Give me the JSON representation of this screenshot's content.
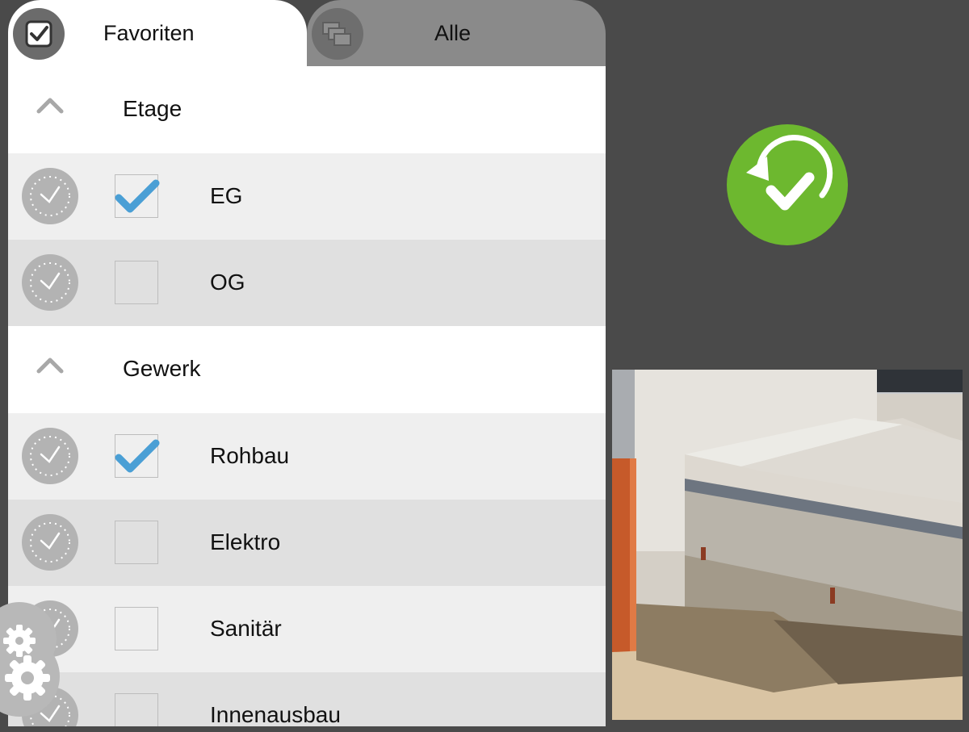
{
  "tabs": {
    "favorites": {
      "label": "Favoriten",
      "icon": "checkbox-icon",
      "active": true
    },
    "all": {
      "label": "Alle",
      "icon": "layers-icon",
      "active": false
    }
  },
  "sections": [
    {
      "title": "Etage",
      "items": [
        {
          "label": "EG",
          "checked": true
        },
        {
          "label": "OG",
          "checked": false
        }
      ]
    },
    {
      "title": "Gewerk",
      "items": [
        {
          "label": "Rohbau",
          "checked": true
        },
        {
          "label": "Elektro",
          "checked": false
        },
        {
          "label": "Sanitär",
          "checked": false
        },
        {
          "label": "Innenausbau",
          "checked": false
        }
      ]
    }
  ],
  "sync_button": {
    "icon": "sync-check-icon"
  },
  "settings_button": {
    "icon": "gear-icon"
  },
  "colors": {
    "background": "#4a4a4a",
    "accent_green": "#6db82f",
    "check_blue": "#4a9fd5",
    "inactive_tab": "#8a8a8a"
  }
}
